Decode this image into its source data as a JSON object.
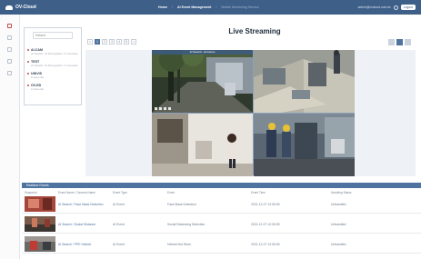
{
  "app": {
    "name": "OV-Cloud"
  },
  "topnav": {
    "home": "Home",
    "separator": "/",
    "section": "AI Event Management",
    "page": "Mobile Monitoring Service"
  },
  "user": {
    "email": "admin@ovcloud.com.tw",
    "logout": "Logout"
  },
  "devices": {
    "search_placeholder": "Default",
    "items": [
      {
        "name": "AI-CAM",
        "sub": "AI Search / AI Recognition / 5 cameras"
      },
      {
        "name": "TEST",
        "sub": "AI Search / AI Recognition / 2 cameras"
      },
      {
        "name": "UNIVIS",
        "sub": "6 cameras"
      },
      {
        "name": "OV-ED",
        "sub": "2 cameras"
      }
    ]
  },
  "main": {
    "title": "Live Streaming",
    "pages": [
      "<",
      "1",
      "2",
      "3",
      "4",
      "5",
      ">"
    ],
    "active_page": "1"
  },
  "cameras": [
    {
      "label": "AI Search - Entrance"
    },
    {
      "label": ""
    },
    {
      "label": ""
    },
    {
      "label": ""
    }
  ],
  "events": {
    "bar_title": "Realtime Events",
    "columns": [
      "Snapshot",
      "Event Name / Camera Name",
      "Event Type",
      "Event",
      "Event Time",
      "Handling Status"
    ],
    "rows": [
      {
        "name": "AI Search / Face Mask Detection",
        "type": "AI Event",
        "event": "Face Mask Detection",
        "time": "2021-12-07 12:05:05",
        "status": "Unhandled"
      },
      {
        "name": "AI Search / Social Distance",
        "type": "AI Event",
        "event": "Social Distancing Detection",
        "time": "2021-12-07 12:05:05",
        "status": "Unhandled"
      },
      {
        "name": "AI Search / PPE Helmet",
        "type": "AI Event",
        "event": "Helmet Not Worn",
        "time": "2021-12-07 12:05:05",
        "status": "Unhandled"
      }
    ]
  }
}
